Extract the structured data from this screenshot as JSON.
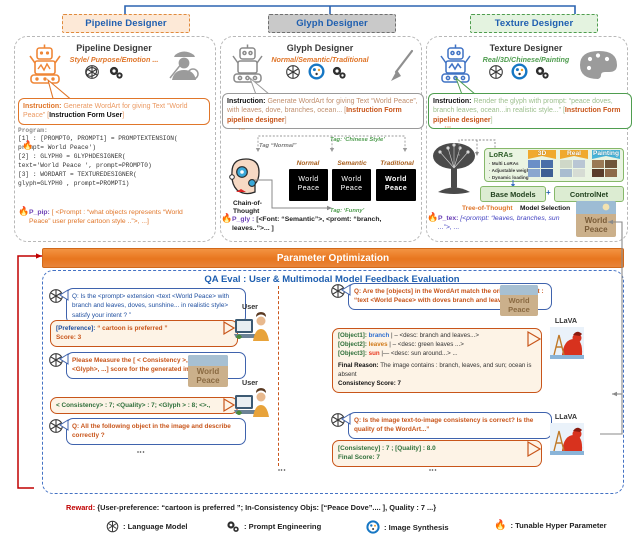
{
  "top_tabs": [
    {
      "label": "Pipeline Designer",
      "accent": "#e08a3c"
    },
    {
      "label": "Glyph Designer",
      "accent": "#6f6f6f"
    },
    {
      "label": "Texture Designer",
      "accent": "#4f9d4f"
    }
  ],
  "pipeline": {
    "title": "Pipeline Designer",
    "subtitle": "Style/ Purpose/Emotion ...",
    "instruction_label": "Instruction:",
    "instruction_text": "Generate WordArt for giving Text “World Peace” [",
    "instruction_tag": "Instruction Form User",
    "instruction_close": "]",
    "program_label": "Program:",
    "code": [
      "[1] : [PROMPT0, PROMPT1] = PROMPTEXTENSION(",
      "        prompt= World Peace')",
      "[2] : GLYPH0 = GLYPHDESIGNER(",
      "        text='World Peace ', prompt=PROMPT0)",
      "[3] : WORDART = TEXTUREDESIGNER(",
      "        glyph=GLYPH0 , prompt=PROMPT1)"
    ],
    "param_name": "P_pip:",
    "param_text": "[ <Prompt : “what objects represents “World Peace” user prefer cartoon style ..”>, ...]"
  },
  "glyph": {
    "title": "Glyph Designer",
    "subtitle": "Normal/Semantic/Traditional",
    "instruction_label": "Instruction:",
    "instruction_text": "Generate WordArt for giving Text “World Peace”, with leaves, dove, branches, ocean... [",
    "instruction_tag": "Instruction Form pipeline designer",
    "instruction_close": "]",
    "tags": [
      "Tag “Normal”",
      "Tag: ‘Chinese Style’",
      "Tag: ‘Funny’"
    ],
    "cards": [
      {
        "style": "Normal",
        "line1": "World",
        "line2": "Peace"
      },
      {
        "style": "Semantic",
        "line1": "World",
        "line2": "Peace"
      },
      {
        "style": "Traditional",
        "line1": "World",
        "line2": "Peace"
      }
    ],
    "cot_label": "Chain-of-Thought",
    "param_name": "P_gly :",
    "param_text": "[<Font: “Semantic”>, <promt: “branch, leaves..”>... ]"
  },
  "texture": {
    "title": "Texture Designer",
    "subtitle": "Real/3D/Chinese/Painting",
    "instruction_label": "Instruction:",
    "instruction_text": "Render the glyph with prompt: “peace doves, branch leaves, ocean...in realistic style...” [",
    "instruction_tag": "Instruction Form pipeline designer",
    "instruction_close": "]",
    "loras_title": "LoRAs",
    "loras_bullets": [
      "Multi LoRAs",
      "Adjustable weight",
      "Dynamic loading"
    ],
    "lora_ribbons": [
      "3D",
      "Real",
      "Painting"
    ],
    "base_models": "Base Models",
    "controlnet": "ControlNet",
    "plus": "+",
    "tot_label": "Tree-of-Thought",
    "tot_value": "Model Selection",
    "param_name": "P_tex:",
    "param_text": "[<prompt: “leaves, branches, sun ...”>, ..."
  },
  "optimization": {
    "bar_label": "Parameter Optimization",
    "qa_title": "QA Eval : User & Multimodal Model Feedback Evaluation",
    "left_column": [
      {
        "type": "question",
        "text": "Q: Is the  <prompt> extension <text <World Peace> with branch and leaves, doves, sunshine... in realistic style> satisfy your intent ? ”"
      },
      {
        "type": "answer",
        "line1_key": "[Preference]:",
        "line1_val": " “ cartoon is preferred ”",
        "line2": "Score: 3"
      },
      {
        "type": "question2",
        "text": "Please Measure the [ < Consistency >, <Quality>, <Glyph>, ...]  score for the generated image ,"
      },
      {
        "type": "answer2",
        "text": "< Consistency> : 7;  <Quality> : 7;  <Glyph > : 8; <>.,"
      },
      {
        "type": "question3",
        "text": "Q: All the following  object in the image and describe correctly ?"
      }
    ],
    "left_roles": [
      "User",
      "User"
    ],
    "right_column": [
      {
        "type": "question",
        "text": "Q: Are the  [objects]   in the WordArt match the original prompt : “text <World Peace> with doves branch and leaves, sun...”"
      },
      {
        "type": "objects",
        "rows": [
          {
            "key": "[Object1]:",
            "name": "branch",
            "desc": "| – <desc: branch and leaves...>"
          },
          {
            "key": "[Object2]:",
            "name": "leaves",
            "desc": "| – <desc: green leaves ...>"
          },
          {
            "key": "[Object3]:",
            "name": "sun",
            "desc": "|— <desc: sun around...> ..."
          }
        ],
        "reason_label": "Final Reason:",
        "reason_text": "The image contains : branch, leaves, and sun; ocean is absent",
        "score": "Consistency  Score: 7"
      },
      {
        "type": "question2",
        "text": "Q: Is the  image text-to-image consistency is correct? Is the quality of the WordArt...”"
      },
      {
        "type": "answer2",
        "line1": "[Consistency]    : 7  ;   [Quality] : 8.0",
        "line2": "Final Score: 7"
      }
    ],
    "right_roles": [
      "LLaVA",
      "LLaVA"
    ],
    "reward_label": "Reward:",
    "reward_text": "{User-preference: “cartoon is preferred ”;   In-Consistency Objs: [“Peace Dove”.... ],  Quality : 7 ...}",
    "reward_obj": "“Peace Dove”",
    "reward_quality": "7 ..."
  },
  "legend": [
    {
      "icon": "language-model-icon",
      "label": ": Language Model"
    },
    {
      "icon": "prompt-engineering-icon",
      "label": ": Prompt Engineering"
    },
    {
      "icon": "image-synthesis-icon",
      "label": ": Image Synthesis"
    },
    {
      "icon": "flame-icon",
      "label": ": Tunable Hyper Parameter"
    }
  ],
  "colors": {
    "orange": "#e0762a",
    "blue": "#1f5fb0",
    "green": "#4f9d4f",
    "grey": "#6f6f6f",
    "red": "#c00000"
  }
}
